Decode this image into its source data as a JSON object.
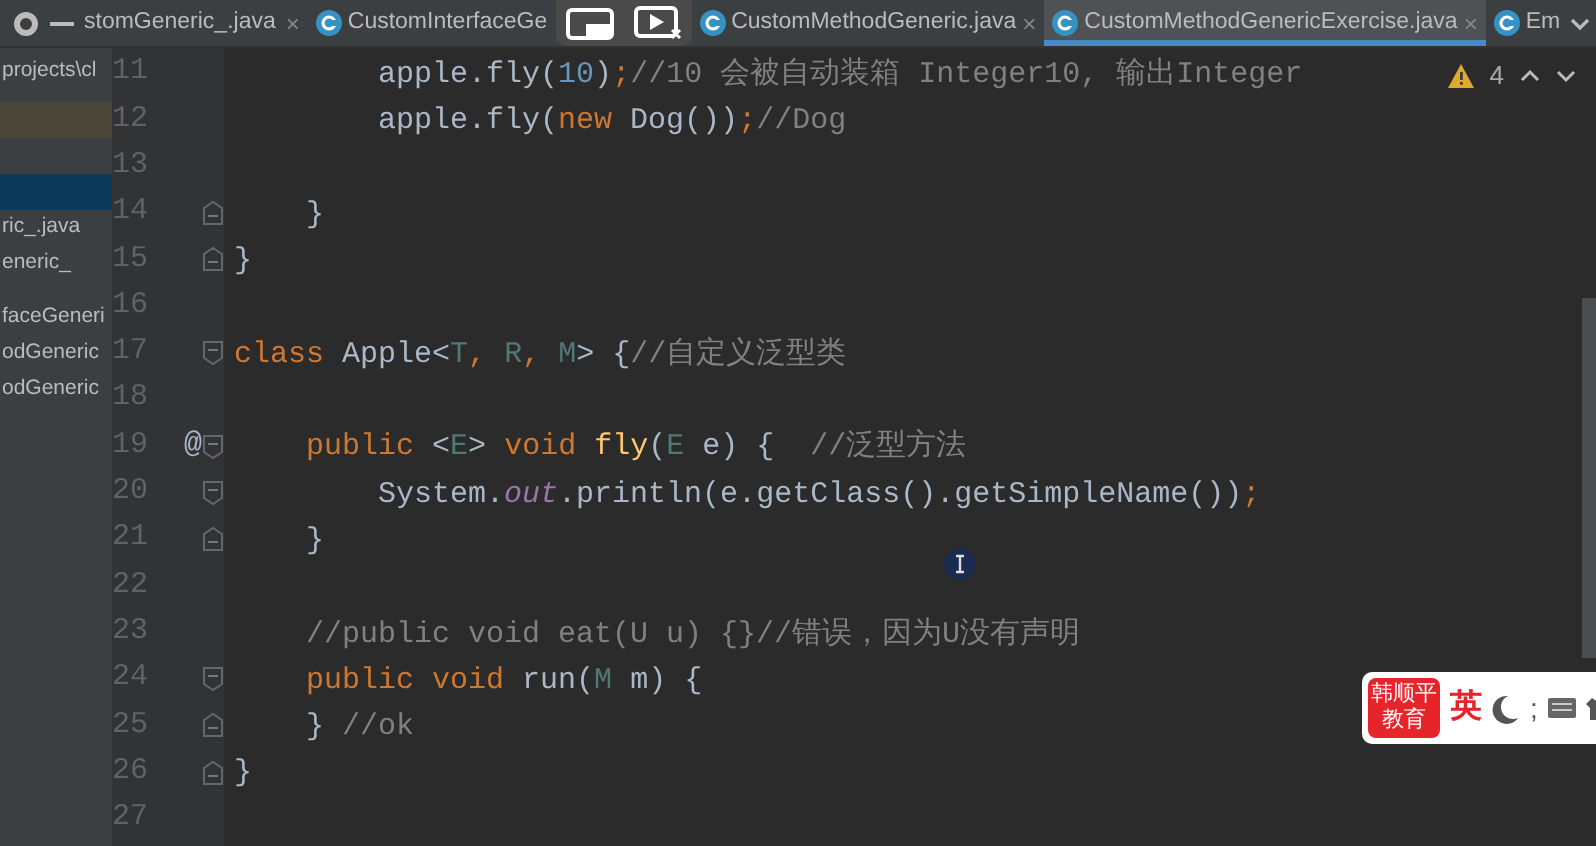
{
  "project_panel": {
    "header": "stomGeneric_.java",
    "header_close": "×",
    "path": "projects\\cl",
    "items": [
      {
        "selected": false,
        "highlighted": true
      },
      {
        "selected": true,
        "highlighted": false
      },
      {
        "label": "ric_.java",
        "selected": false,
        "highlighted": false
      },
      {
        "label": "eneric_",
        "selected": false,
        "highlighted": false
      },
      {
        "label": "faceGeneri",
        "selected": false,
        "highlighted": false
      },
      {
        "label": "odGeneric",
        "selected": false,
        "highlighted": false
      },
      {
        "label": "odGeneric",
        "selected": false,
        "highlighted": false
      }
    ]
  },
  "tabs": [
    {
      "label": "CustomInterfaceGe",
      "selected": false
    },
    {
      "label": "CustomMethodGeneric.java",
      "selected": false,
      "close": "×"
    },
    {
      "label": "CustomMethodGenericExercise.java",
      "selected": true,
      "close": "×"
    },
    {
      "label": "Em",
      "selected": false
    }
  ],
  "inspections": {
    "warnings": "4"
  },
  "editor": {
    "lines": [
      {
        "number": "11",
        "fold_start": false,
        "fold_end": false,
        "tokens": [
          {
            "kind": "plain",
            "text": "        apple.fly("
          },
          {
            "kind": "number",
            "text": "10"
          },
          {
            "kind": "plain",
            "text": ")"
          },
          {
            "kind": "keyword",
            "text": ";"
          },
          {
            "kind": "comment",
            "text": "//10 会被自动装箱 Integer10, 输出Integer"
          }
        ]
      },
      {
        "number": "12",
        "fold_start": false,
        "fold_end": false,
        "tokens": [
          {
            "kind": "plain",
            "text": "        apple.fly("
          },
          {
            "kind": "keyword",
            "text": "new"
          },
          {
            "kind": "plain",
            "text": " Dog())"
          },
          {
            "kind": "keyword",
            "text": ";"
          },
          {
            "kind": "comment",
            "text": "//Dog"
          }
        ]
      },
      {
        "number": "13",
        "fold_start": false,
        "fold_end": false
      },
      {
        "number": "14",
        "fold_start": false,
        "fold_end": true,
        "tokens": [
          {
            "kind": "plain",
            "text": "    }"
          }
        ]
      },
      {
        "number": "15",
        "fold_start": false,
        "fold_end": true,
        "tokens": [
          {
            "kind": "plain",
            "text": "}"
          }
        ]
      },
      {
        "number": "16",
        "fold_start": false,
        "fold_end": false
      },
      {
        "number": "17",
        "fold_start": true,
        "fold_end": false,
        "tokens": [
          {
            "kind": "keyword",
            "text": "class"
          },
          {
            "kind": "plain",
            "text": " Apple<"
          },
          {
            "kind": "param",
            "text": "T"
          },
          {
            "kind": "keyword",
            "text": ", "
          },
          {
            "kind": "param",
            "text": "R"
          },
          {
            "kind": "keyword",
            "text": ", "
          },
          {
            "kind": "param",
            "text": "M"
          },
          {
            "kind": "plain",
            "text": "> {"
          },
          {
            "kind": "comment",
            "text": "//自定义泛型类"
          }
        ]
      },
      {
        "number": "18",
        "fold_start": false,
        "fold_end": false
      },
      {
        "number": "19",
        "gutter": "@",
        "fold_start": true,
        "fold_end": false,
        "tokens": [
          {
            "kind": "keyword",
            "text": "    public"
          },
          {
            "kind": "plain",
            "text": " <"
          },
          {
            "kind": "param",
            "text": "E"
          },
          {
            "kind": "plain",
            "text": "> "
          },
          {
            "kind": "keyword",
            "text": "void "
          },
          {
            "kind": "method",
            "text": "fly"
          },
          {
            "kind": "plain",
            "text": "("
          },
          {
            "kind": "param",
            "text": "E"
          },
          {
            "kind": "plain",
            "text": " e) {  "
          },
          {
            "kind": "comment",
            "text": "//泛型方法"
          }
        ]
      },
      {
        "number": "20",
        "fold_start": true,
        "fold_end": false,
        "tokens": [
          {
            "kind": "plain",
            "text": "        System."
          },
          {
            "kind": "field",
            "text": "out"
          },
          {
            "kind": "plain",
            "text": ".println(e.getClass().getSimpleName())"
          },
          {
            "kind": "keyword",
            "text": ";"
          }
        ]
      },
      {
        "number": "21",
        "fold_start": false,
        "fold_end": true,
        "tokens": [
          {
            "kind": "plain",
            "text": "    }"
          }
        ]
      },
      {
        "number": "22",
        "fold_start": false,
        "fold_end": false
      },
      {
        "number": "23",
        "fold_start": false,
        "fold_end": false,
        "tokens": [
          {
            "kind": "comment",
            "text": "    //public void eat(U u) {}//错误，因为U没有声明"
          }
        ]
      },
      {
        "number": "24",
        "fold_start": true,
        "fold_end": false,
        "tokens": [
          {
            "kind": "keyword",
            "text": "    public void"
          },
          {
            "kind": "plain",
            "text": " run("
          },
          {
            "kind": "param",
            "text": "M"
          },
          {
            "kind": "plain",
            "text": " m) {"
          }
        ]
      },
      {
        "number": "25",
        "fold_start": false,
        "fold_end": true,
        "tokens": [
          {
            "kind": "plain",
            "text": "    } "
          },
          {
            "kind": "comment",
            "text": "//ok"
          }
        ]
      },
      {
        "number": "26",
        "fold_start": false,
        "fold_end": true,
        "tokens": [
          {
            "kind": "plain",
            "text": "}"
          }
        ]
      },
      {
        "number": "27",
        "fold_start": false,
        "fold_end": false
      }
    ]
  },
  "ime_bar": {
    "logo": "韩顺平教育",
    "mode": "英",
    "punctuation": ";"
  }
}
